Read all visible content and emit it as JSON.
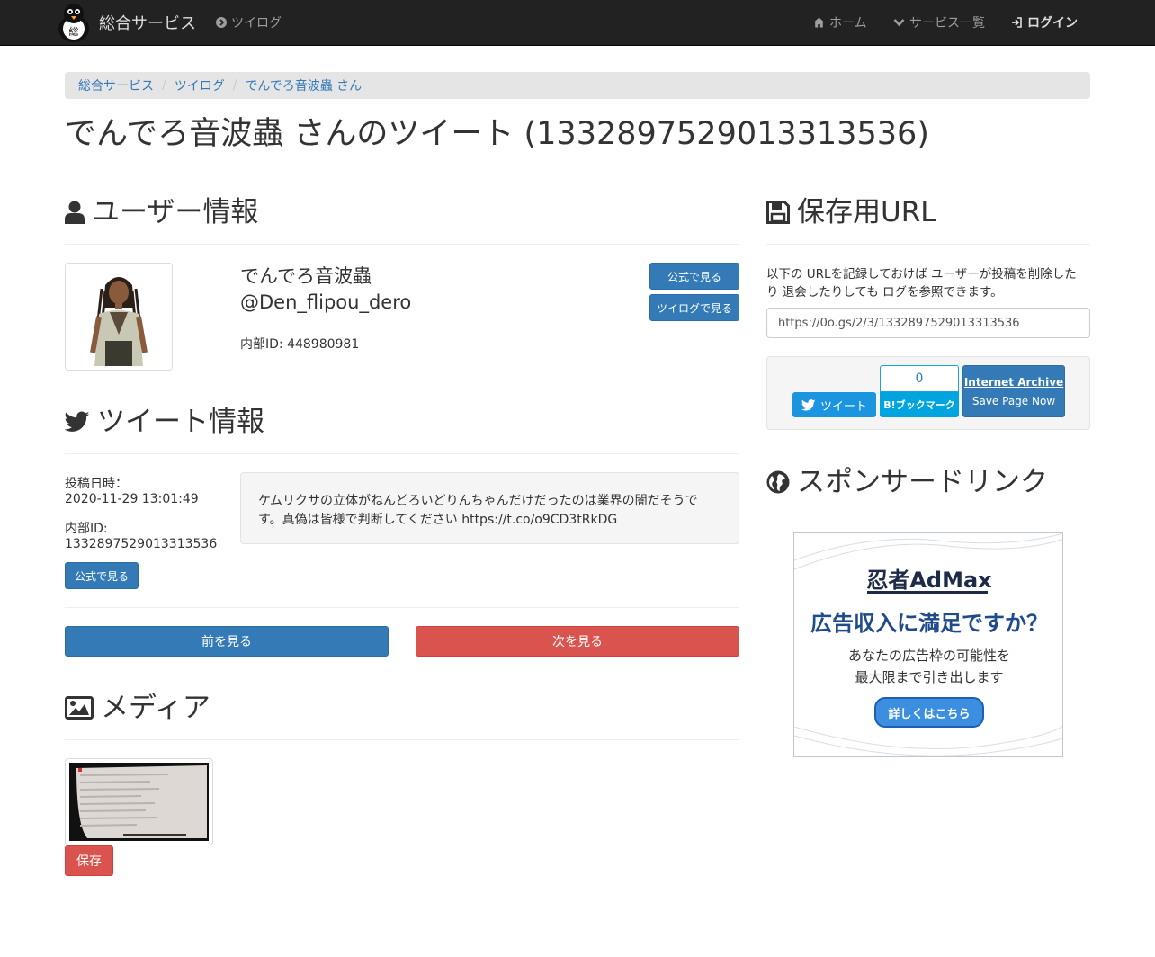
{
  "navbar": {
    "brand_text": "総合サービス",
    "twilog_link": "ツイログ",
    "home": "ホーム",
    "services": "サービス一覧",
    "login": "ログイン"
  },
  "breadcrumb": [
    "総合サービス",
    "ツイログ",
    "でんでろ音波蟲 さん"
  ],
  "page_title": "でんでろ音波蟲 さんのツイート (1332897529013313536)",
  "user_section": {
    "heading": "ユーザー情報",
    "display_name": "でんでろ音波蟲",
    "screen_name": "@Den_flipou_dero",
    "internal_id": "内部ID: 448980981",
    "official_button": "公式で見る",
    "twilog_button": "ツイログで見る"
  },
  "tweet_section": {
    "heading": "ツイート情報",
    "posted_label": "投稿日時：",
    "posted_at": "2020-11-29 13:01:49",
    "id_label": "内部ID:",
    "id_value": "1332897529013313536",
    "official_button": "公式で見る",
    "text_line1": "ケムリクサの立体がねんどろいどりんちゃんだけだったのは業界の闇だそうで",
    "text_line2": "す。真偽は皆様で判断してください https://t.co/o9CD3tRkDG"
  },
  "pager": {
    "prev": "前を見る",
    "next": "次を見る"
  },
  "media_section": {
    "heading": "メディア",
    "save_button": "保存"
  },
  "save_url_section": {
    "heading": "保存用URL",
    "description_line1": "以下の URLを記録しておけば ユーザーが投稿を削除した",
    "description_line2": "り 退会したりしても ログを参照できます。",
    "url": "https://0o.gs/2/3/1332897529013313536",
    "tweet_button": "ツイート",
    "hatena_count": "0",
    "hatena_label": "B!ブックマーク",
    "archive_title": "Internet Archive",
    "archive_sub": "Save Page Now"
  },
  "sponsor_section": {
    "heading": "スポンサードリンク",
    "ad_brand": "忍者AdMax",
    "ad_headline": "広告収入に満足ですか？",
    "ad_line1": "あなたの広告枠の可能性を",
    "ad_line2": "最大限まで引き出します",
    "ad_button": "詳しくはこちら"
  },
  "colors": {
    "navbar_bg": "#222222",
    "primary": "#337ab7",
    "danger": "#d9534f",
    "twitter": "#1b95e0",
    "hatena": "#00a4de"
  }
}
